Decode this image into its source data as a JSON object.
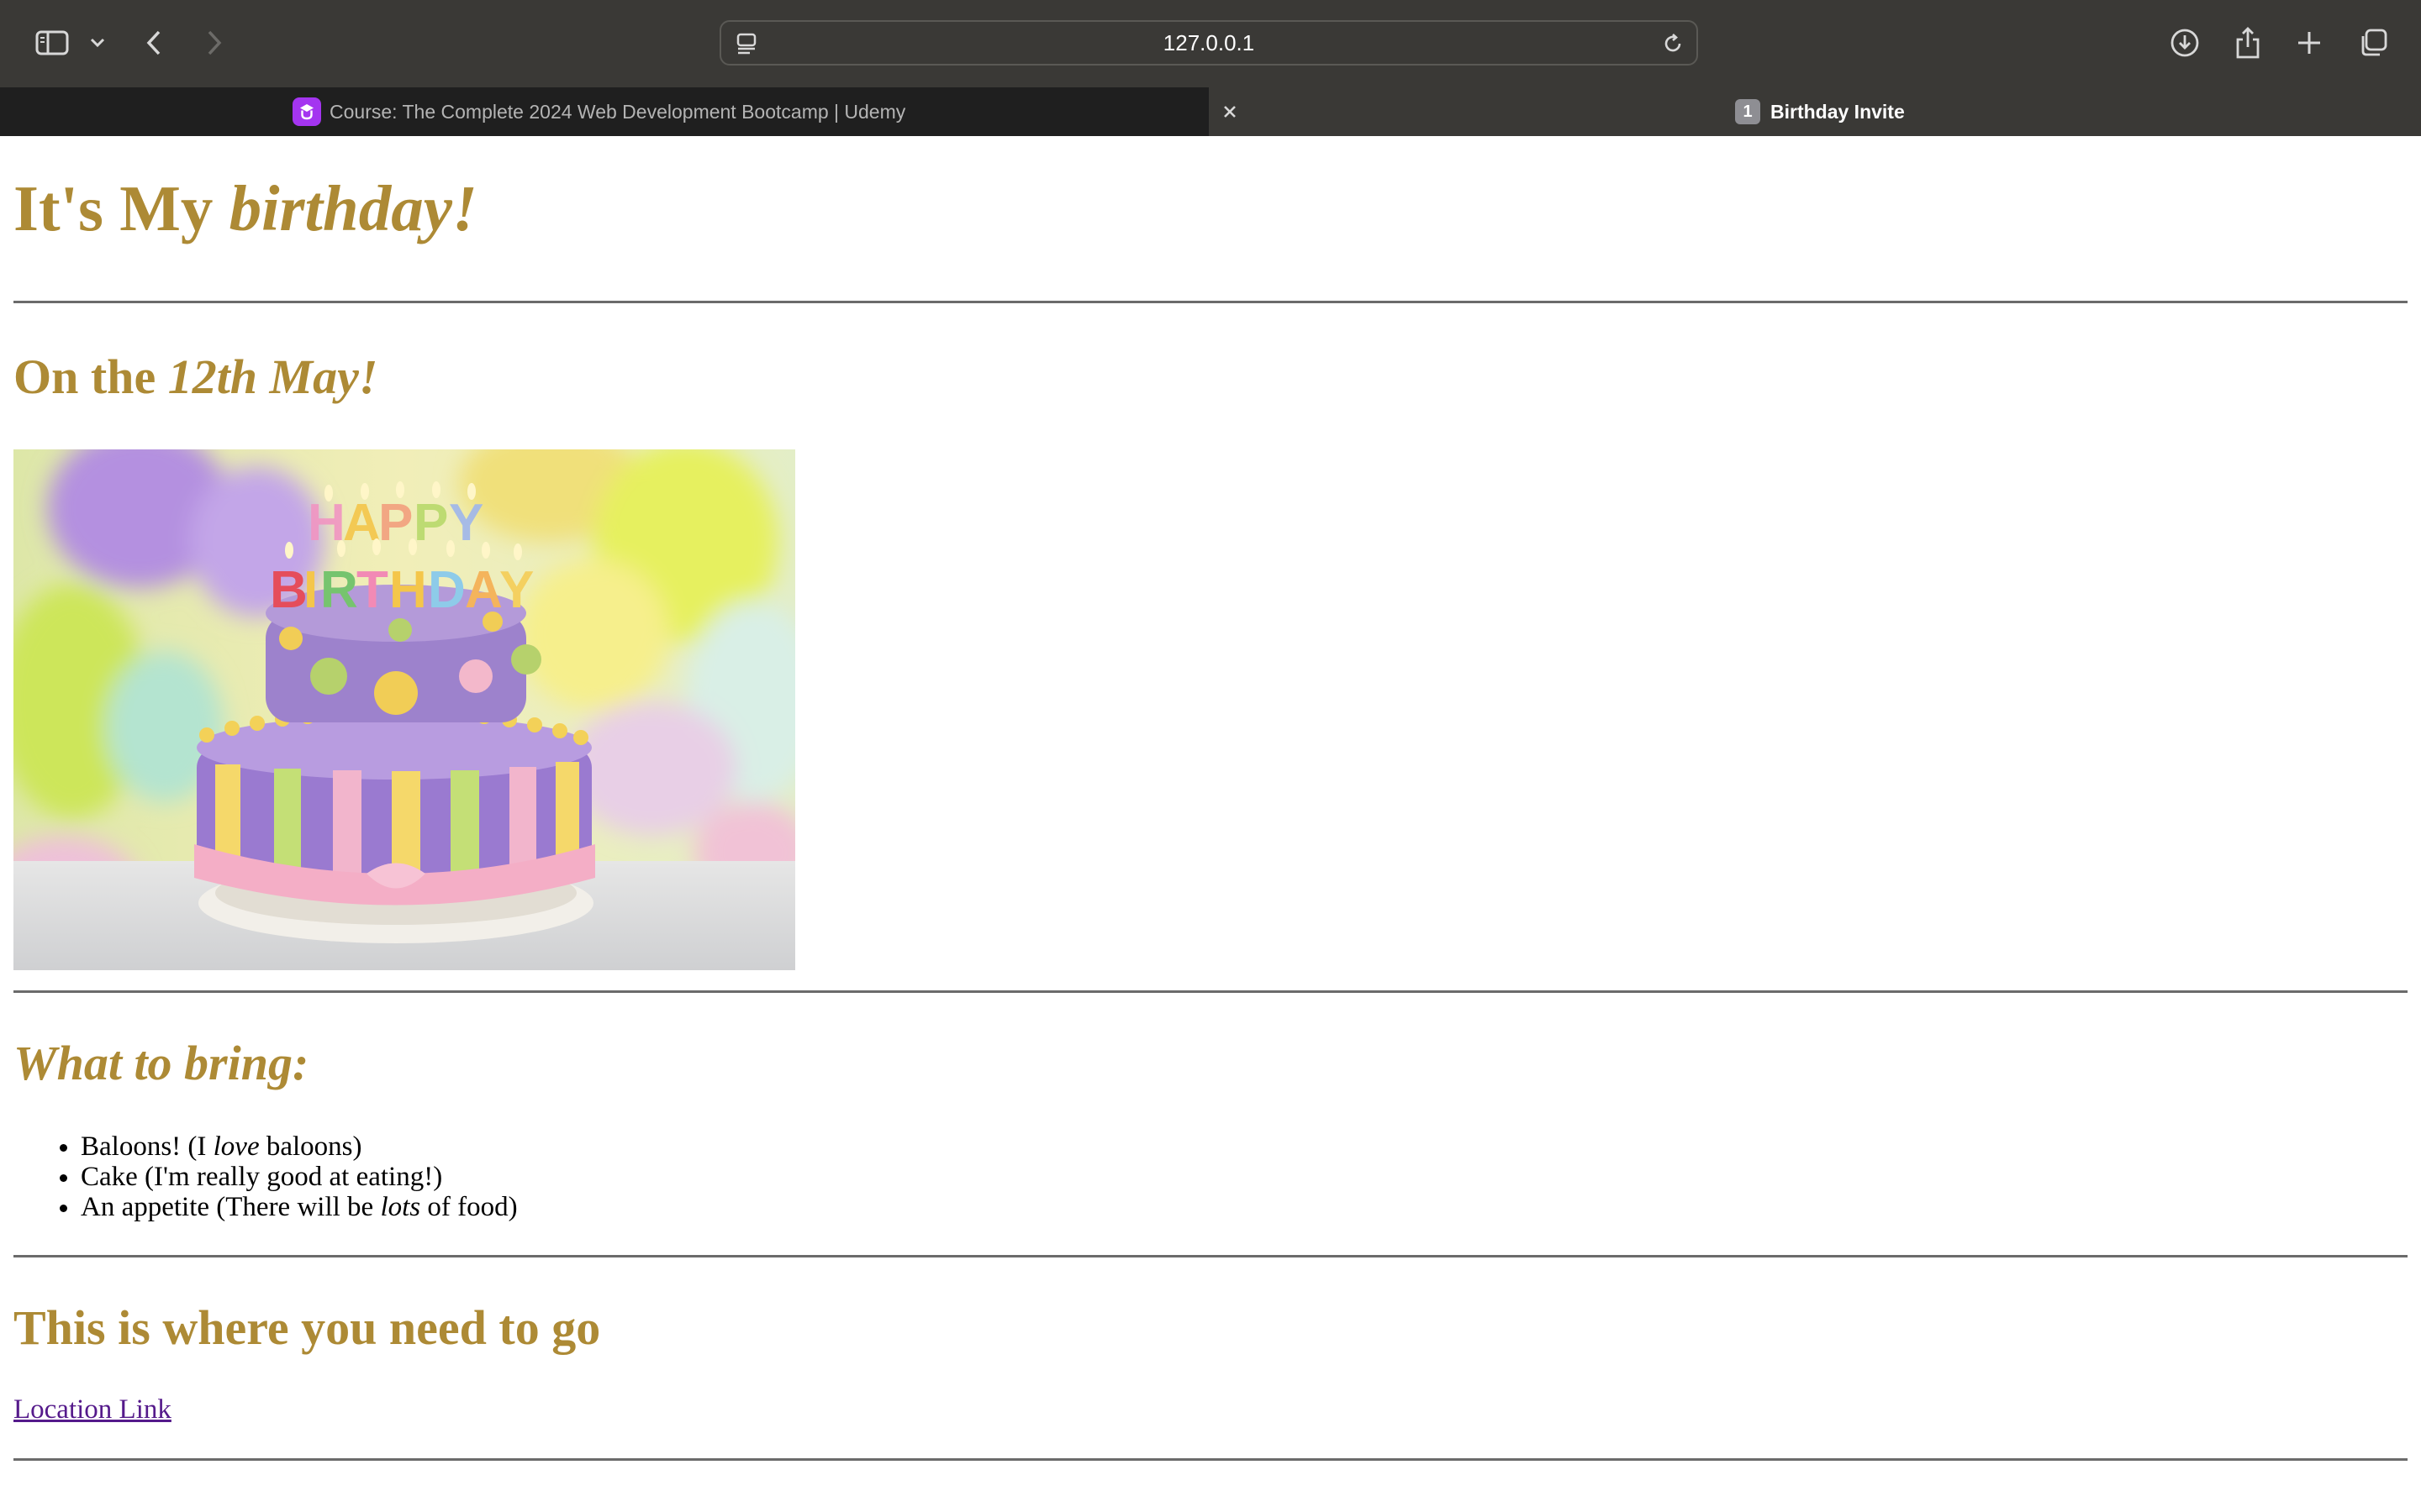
{
  "browser": {
    "address": "127.0.0.1",
    "tabs": [
      {
        "label": "Course: The Complete 2024 Web Development Bootcamp | Udemy",
        "favicon": "udemy-icon",
        "active": false
      },
      {
        "label": "Birthday Invite",
        "favicon": "number-1-icon",
        "favicon_text": "1",
        "active": true
      }
    ],
    "icons": [
      "sidebar-icon",
      "chevron-down-icon",
      "back-icon",
      "forward-icon",
      "page-menu-icon",
      "reload-icon",
      "download-icon",
      "share-icon",
      "new-tab-icon",
      "tab-overview-icon",
      "close-icon"
    ]
  },
  "page": {
    "title": {
      "plain": "It's My ",
      "emph": "birthday!"
    },
    "date": {
      "plain": "On the ",
      "emph": "12th May!"
    },
    "image": {
      "subject": "birthday-cake",
      "cake_text": "HAPPY BIRTHDAY"
    },
    "bring_heading": "What to bring:",
    "bring_items": [
      {
        "pre": "Baloons! (I ",
        "emph": "love",
        "post": " baloons)"
      },
      {
        "pre": "Cake (I'm really good at eating!)",
        "emph": "",
        "post": ""
      },
      {
        "pre": "An appetite (There will be ",
        "emph": "lots",
        "post": " of food)"
      }
    ],
    "where_heading": "This is where you need to go",
    "link_text": "Location Link"
  },
  "colors": {
    "heading": "#ad8a35",
    "link": "#551a8b",
    "toolbar": "#3a3936",
    "inactive_tab": "#1f1f1f"
  }
}
